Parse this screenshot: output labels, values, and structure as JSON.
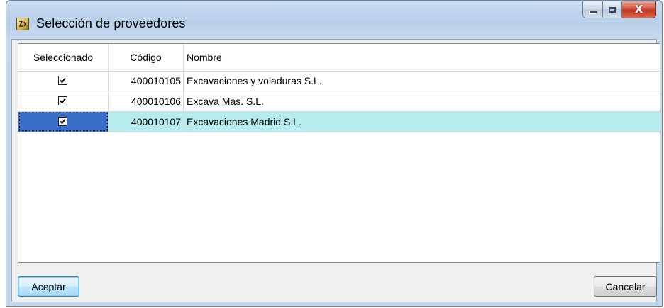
{
  "window": {
    "title": "Selección de proveedores",
    "controls": {
      "minimize_icon": "minimize-icon",
      "maximize_icon": "maximize-icon",
      "close_icon": "close-icon",
      "close_glyph": "X"
    }
  },
  "grid": {
    "columns": [
      "Seleccionado",
      "Código",
      "Nombre"
    ],
    "rows": [
      {
        "selected": true,
        "code": "400010105",
        "name": "Excavaciones y voladuras S.L."
      },
      {
        "selected": true,
        "code": "400010106",
        "name": "Excava Mas. S.L."
      },
      {
        "selected": true,
        "code": "400010107",
        "name": "Excavaciones Madrid S.L.",
        "highlighted": true
      }
    ]
  },
  "buttons": {
    "accept": "Aceptar",
    "cancel": "Cancelar"
  },
  "colors": {
    "row_highlight": "#b7ecec",
    "cell_focus": "#3a6ec8",
    "window_frame": "#c2d6ec"
  }
}
